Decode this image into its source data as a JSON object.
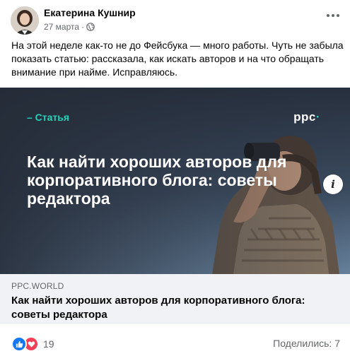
{
  "post": {
    "author": "Екатерина Кушнир",
    "date": "27 марта",
    "separator": "·",
    "privacy_icon": "globe-icon",
    "more_icon": "more-dots-icon",
    "text": "На этой неделе как-то не до Фейсбука — много работы. Чуть не забыла показать статью: рассказала, как искать авторов и на что обращать внимание при найме. Исправляюсь."
  },
  "preview": {
    "tag": "– Статья",
    "logo_text": "ppc",
    "logo_mark": "·",
    "headline": "Как найти хороших авторов для корпоративного блога: советы редактора",
    "info_label": "i",
    "accent_color": "#22d3b6",
    "bg_color": "#2c3442"
  },
  "link": {
    "domain": "PPC.WORLD",
    "title": "Как найти хороших авторов для корпоративного блога: советы редактора"
  },
  "footer": {
    "reactions": [
      "like-icon",
      "love-icon"
    ],
    "reaction_count": "19",
    "shares": "Поделились: 7"
  }
}
